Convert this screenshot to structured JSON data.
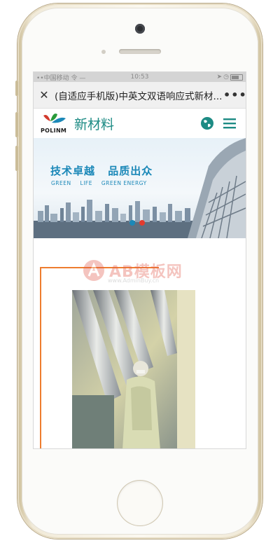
{
  "statusbar": {
    "carrier": "••中国移动 令 —",
    "time": "10:53",
    "icons": [
      "location-icon",
      "alarm-icon",
      "battery-icon"
    ]
  },
  "titlebar": {
    "close_glyph": "✕",
    "title": "(自适应手机版)中英文双语响应式新材...",
    "more_glyph": "•••"
  },
  "site": {
    "logo_brand": "POLINM",
    "logo_name": "新材料",
    "accent_color": "#1d8b84",
    "icons": [
      "globe-icon",
      "menu-icon"
    ]
  },
  "banner": {
    "slogan_1": "技术卓越",
    "slogan_2": "品质出众",
    "sub_1": "GREEN",
    "sub_2": "LIFE",
    "sub_3": "GREEN ENERGY",
    "slides": [
      {
        "color": "#1b88b8",
        "active": true
      },
      {
        "color": "#e23b2e",
        "active": false
      }
    ]
  },
  "watermark": {
    "text": "AB模板网",
    "sub": "www.AdminBuy.cn"
  },
  "colors": {
    "orange_frame": "#ee7d2f",
    "phone_gold": "#cdbf9a"
  }
}
